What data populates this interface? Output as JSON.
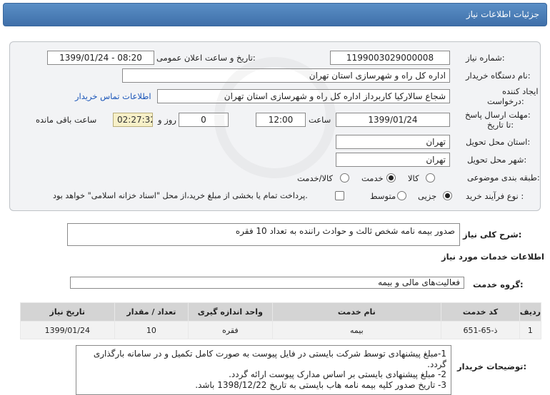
{
  "header": {
    "title": "جزئیات اطلاعات نیاز"
  },
  "need_number": {
    "label": "شماره نیاز:",
    "value": "1199003029000008"
  },
  "announce_datetime": {
    "label": "تاریخ و ساعت اعلان عمومی:",
    "value": "1399/01/24 - 08:20"
  },
  "buyer_org": {
    "label": "نام دستگاه خریدار:",
    "value": "اداره کل راه و شهرسازی استان تهران"
  },
  "requester": {
    "label_line1": "ایجاد کننده",
    "label_line2": "درخواست:",
    "value": "شجاع سالارکیا کاربرداز اداره کل راه و شهرسازی استان تهران",
    "contact_link": "اطلاعات تماس خریدار"
  },
  "deadline": {
    "label_line1": "مهلت ارسال پاسخ:",
    "label_line2": "تا تاریخ:",
    "date": "1399/01/24",
    "time_label": "ساعت",
    "time": "12:00",
    "days": "0",
    "days_label": "روز و",
    "remaining": "02:27:32",
    "remaining_label": "ساعت باقی مانده"
  },
  "delivery_province": {
    "label": "استان محل تحویل:",
    "value": "تهران"
  },
  "delivery_city": {
    "label": "شهر محل تحویل:",
    "value": "تهران"
  },
  "category": {
    "label": "طبقه بندی موضوعی:",
    "options": [
      "کالا",
      "خدمت",
      "کالا/خدمت"
    ],
    "selected": "خدمت"
  },
  "process": {
    "label": "نوع فرآیند خرید :",
    "options": [
      "جزیی",
      "متوسط"
    ],
    "selected": "جزیی",
    "payment_note": "پرداخت تمام یا بخشی از مبلغ خرید،از محل \"اسناد خزانه اسلامی\" خواهد بود."
  },
  "summary": {
    "label": "شرح کلی نیاز:",
    "value": "صدور بیمه نامه شخص ثالث و حوادث راننده به تعداد 10 فقره"
  },
  "services_info": {
    "title": "اطلاعات خدمات مورد نیاز"
  },
  "service_group": {
    "label": "گروه خدمت:",
    "value": "فعالیت‌های مالی و بیمه"
  },
  "table": {
    "headers": [
      "ردیف",
      "کد خدمت",
      "نام خدمت",
      "واحد اندازه گیری",
      "تعداد / مقدار",
      "تاریخ نیاز"
    ],
    "rows": [
      [
        "1",
        "ذ-65-651",
        "بیمه",
        "فقره",
        "10",
        "1399/01/24"
      ]
    ]
  },
  "buyer_notes": {
    "label": "توضیحات خریدار:",
    "lines": [
      "1-مبلغ پیشنهادی توسط شرکت بایستی در فایل پیوست به صورت کامل تکمیل و در سامانه بارگذاری",
      "گردد.",
      "2- مبلغ پیشنهادی بایستی بر اساس مدارک پیوست ارائه گردد.",
      "3- تاریخ صدور کلیه بیمه نامه هاب بایستی به تاریخ 1398/12/22 باشد."
    ]
  }
}
